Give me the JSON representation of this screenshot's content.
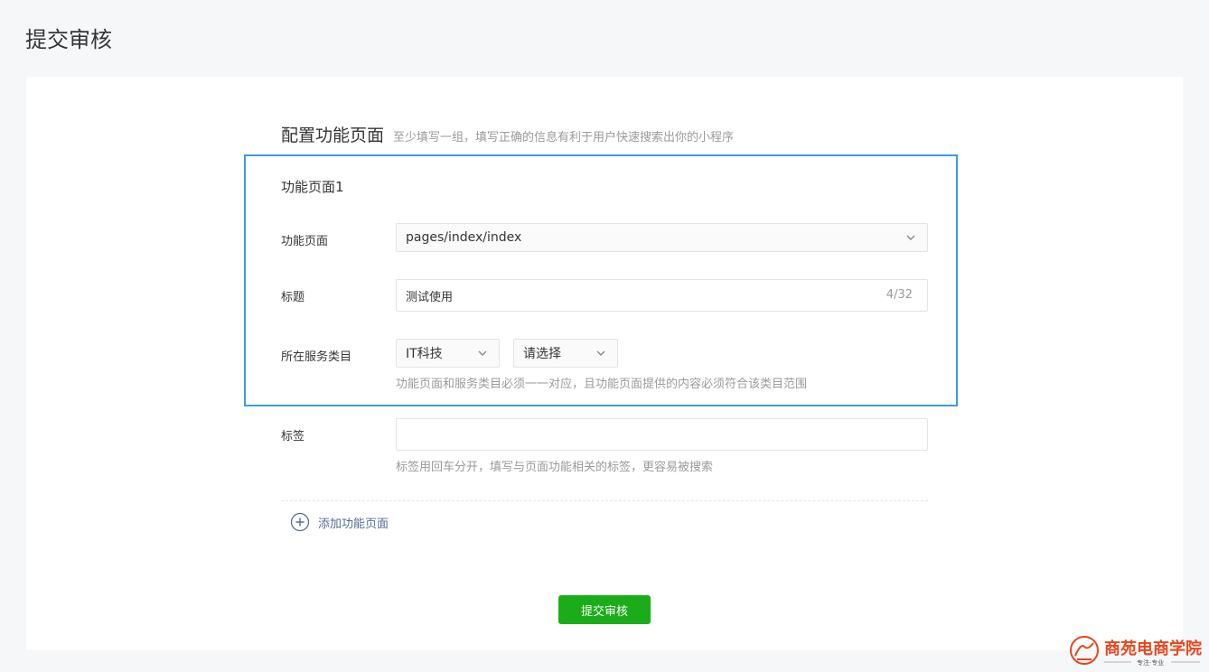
{
  "page": {
    "title": "提交审核"
  },
  "section": {
    "title": "配置功能页面",
    "tip": "至少填写一组，填写正确的信息有利于用户快速搜索出你的小程序"
  },
  "group": {
    "title": "功能页面1",
    "page_label": "功能页面",
    "page_value": "pages/index/index",
    "title_label": "标题",
    "title_value": "测试使用",
    "title_counter": "4/32",
    "category_label": "所在服务类目",
    "category_primary": "IT科技",
    "category_secondary": "请选择",
    "category_hint": "功能页面和服务类目必须一一对应，且功能页面提供的内容必须符合该类目范围"
  },
  "tags": {
    "label": "标签",
    "value": "",
    "hint": "标签用回车分开，填写与页面功能相关的标签，更容易被搜索"
  },
  "actions": {
    "add_page": "添加功能页面",
    "submit": "提交审核"
  },
  "watermark": {
    "brand": "商苑电商学院",
    "slogan": "专注·专业"
  },
  "colors": {
    "highlight": "#3b9de2",
    "primary_button": "#1aad19",
    "link": "#576b95",
    "logo": "#e8461e"
  },
  "icons": {
    "select_arrow": "chevron-down-icon",
    "add": "plus-circle-icon"
  }
}
